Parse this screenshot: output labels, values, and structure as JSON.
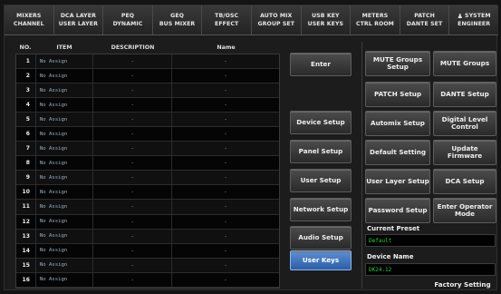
{
  "nav": {
    "tabs": [
      {
        "line1": "MIXERS",
        "line2": "CHANNEL"
      },
      {
        "line1": "DCA LAYER",
        "line2": "USER LAYER"
      },
      {
        "line1": "PEQ",
        "line2": "DYNAMIC"
      },
      {
        "line1": "GEQ",
        "line2": "BUS MIXER"
      },
      {
        "line1": "TB/OSC",
        "line2": "EFFECT"
      },
      {
        "line1": "AUTO MIX",
        "line2": "GROUP SET"
      },
      {
        "line1": "USB KEY",
        "line2": "USER KEYS"
      },
      {
        "line1": "METERS",
        "line2": "CTRL ROOM"
      },
      {
        "line1": "PATCH",
        "line2": "DANTE SET"
      },
      {
        "line1": "SYSTEM",
        "line2": "ENGINEER",
        "icon": "user-icon"
      }
    ]
  },
  "table": {
    "headers": {
      "no": "NO.",
      "item": "ITEM",
      "description": "DESCRIPTION",
      "name": "Name"
    },
    "rows": [
      {
        "no": "1",
        "item": "No Assign",
        "description": "-",
        "name": "-"
      },
      {
        "no": "2",
        "item": "No Assign",
        "description": "-",
        "name": "-"
      },
      {
        "no": "3",
        "item": "No Assign",
        "description": "-",
        "name": "-"
      },
      {
        "no": "4",
        "item": "No Assign",
        "description": "-",
        "name": "-"
      },
      {
        "no": "5",
        "item": "No Assign",
        "description": "-",
        "name": "-"
      },
      {
        "no": "6",
        "item": "No Assign",
        "description": "-",
        "name": "-"
      },
      {
        "no": "7",
        "item": "No Assign",
        "description": "-",
        "name": "-"
      },
      {
        "no": "8",
        "item": "No Assign",
        "description": "-",
        "name": "-"
      },
      {
        "no": "9",
        "item": "No Assign",
        "description": "-",
        "name": "-"
      },
      {
        "no": "10",
        "item": "No Assign",
        "description": "-",
        "name": "-"
      },
      {
        "no": "11",
        "item": "No Assign",
        "description": "-",
        "name": "-"
      },
      {
        "no": "12",
        "item": "No Assign",
        "description": "-",
        "name": "-"
      },
      {
        "no": "13",
        "item": "No Assign",
        "description": "-",
        "name": "-"
      },
      {
        "no": "14",
        "item": "No Assign",
        "description": "-",
        "name": "-"
      },
      {
        "no": "15",
        "item": "No Assign",
        "description": "-",
        "name": "-"
      },
      {
        "no": "16",
        "item": "No Assign",
        "description": "-",
        "name": "-"
      }
    ]
  },
  "middle": {
    "enter": "Enter",
    "device_setup": "Device Setup",
    "panel_setup": "Panel Setup",
    "user_setup": "User Setup",
    "network_setup": "Network Setup",
    "audio_setup": "Audio Setup",
    "user_keys": "User Keys"
  },
  "right": {
    "mute_groups_setup": "MUTE Groups Setup",
    "mute_groups": "MUTE Groups",
    "patch_setup": "PATCH Setup",
    "dante_setup": "DANTE Setup",
    "automix_setup": "Automix Setup",
    "digital_level_control": "Digital Level Control",
    "default_setting": "Default Setting",
    "update_firmware": "Update Firmware",
    "user_layer_setup": "User Layer Setup",
    "dca_setup": "DCA Setup",
    "password_setup": "Password Setup",
    "enter_operator_mode": "Enter Operator Mode",
    "current_preset_label": "Current Preset",
    "current_preset_value": "Default",
    "device_name_label": "Device Name",
    "device_name_value": "DK24.12",
    "factory_setting": "Factory Setting"
  },
  "colors": {
    "accent_active": "#3c72c4",
    "field_text": "#22d02e"
  }
}
